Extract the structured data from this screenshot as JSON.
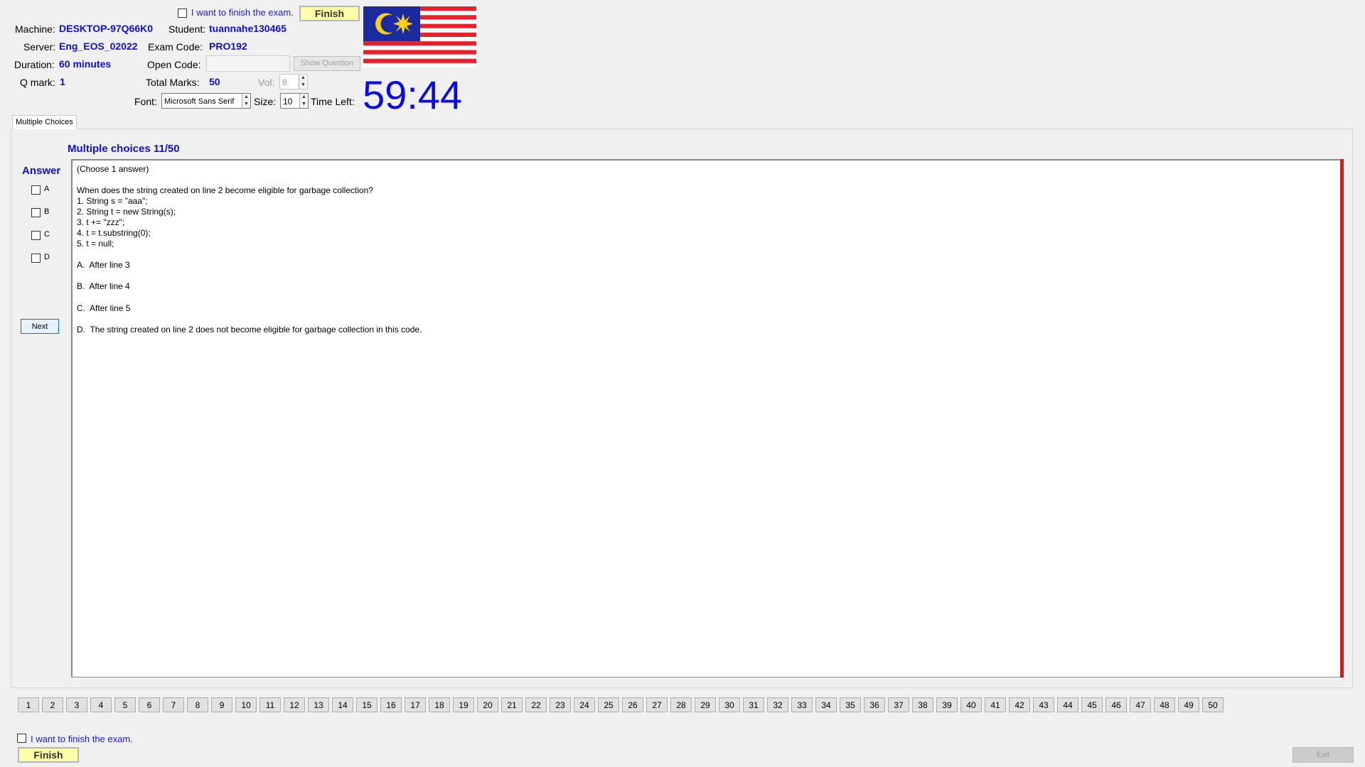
{
  "header": {
    "finish_check_label": "I want to finish the exam.",
    "finish_button": "Finish",
    "machine_label": "Machine:",
    "machine_value": "DESKTOP-97Q66K0",
    "student_label": "Student:",
    "student_value": "tuannahe130465",
    "server_label": "Server:",
    "server_value": "Eng_EOS_02022",
    "exam_code_label": "Exam Code:",
    "exam_code_value": "PRO192",
    "duration_label": "Duration:",
    "duration_value": "60 minutes",
    "open_code_label": "Open Code:",
    "open_code_value": "",
    "show_question_button": "Show Question",
    "qmark_label": "Q mark:",
    "qmark_value": "1",
    "total_marks_label": "Total Marks:",
    "total_marks_value": "50",
    "vol_label": "Vol:",
    "vol_value": "8",
    "font_label": "Font:",
    "font_value": "Microsoft Sans Serif",
    "size_label": "Size:",
    "size_value": "10",
    "time_left_label": "Time Left:",
    "timer": "59:44",
    "flag_icon": "malaysia-flag-icon"
  },
  "tab": {
    "label": "Multiple Choices"
  },
  "question": {
    "heading": "Multiple choices 11/50",
    "answer_label": "Answer",
    "options": [
      "A",
      "B",
      "C",
      "D"
    ],
    "next_button": "Next",
    "instruction": "(Choose 1 answer)",
    "prompt": "When does the string created on line 2 become eligible for garbage collection?",
    "code_lines": [
      "1. String s = \"aaa\";",
      "2. String t = new String(s);",
      "3. t += \"zzz\";",
      "4. t = t.substring(0);",
      "5. t = null;"
    ],
    "choices": [
      "A.  After line 3",
      "B.  After line 4",
      "C.  After line 5",
      "D.  The string created on line 2 does not become eligible for garbage collection in this code."
    ]
  },
  "question_nav": {
    "numbers": [
      "1",
      "2",
      "3",
      "4",
      "5",
      "6",
      "7",
      "8",
      "9",
      "10",
      "11",
      "12",
      "13",
      "14",
      "15",
      "16",
      "17",
      "18",
      "19",
      "20",
      "21",
      "22",
      "23",
      "24",
      "25",
      "26",
      "27",
      "28",
      "29",
      "30",
      "31",
      "32",
      "33",
      "34",
      "35",
      "36",
      "37",
      "38",
      "39",
      "40",
      "41",
      "42",
      "43",
      "44",
      "45",
      "46",
      "47",
      "48",
      "49",
      "50"
    ]
  },
  "footer": {
    "finish_check_label": "I want to finish the exam.",
    "finish_button": "Finish",
    "exit_button": "Exit"
  },
  "colors": {
    "value_blue": "#1010d0",
    "timer_blue": "#0a0ae6",
    "finish_yellow": "#ffffa8",
    "scroll_red": "#ee1111"
  }
}
